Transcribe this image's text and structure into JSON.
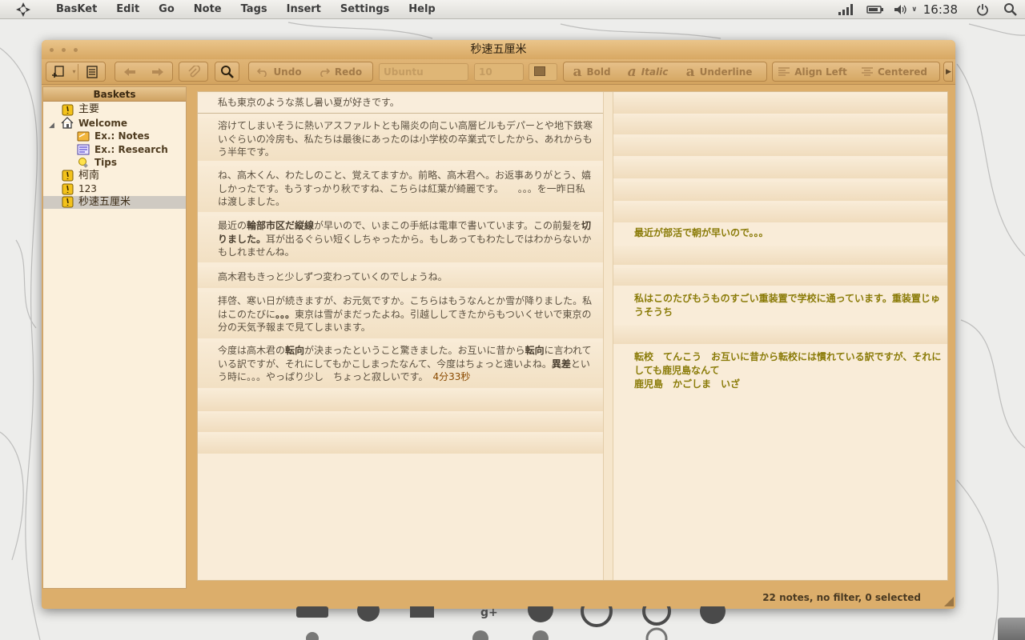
{
  "panel": {
    "menu": [
      "BasKet",
      "Edit",
      "Go",
      "Note",
      "Tags",
      "Insert",
      "Settings",
      "Help"
    ],
    "clock": "16:38",
    "tray_icons": [
      "network-signal-icon",
      "battery-icon",
      "volume-icon",
      "power-icon",
      "search-icon"
    ]
  },
  "window": {
    "title": "秒速五厘米"
  },
  "toolbar": {
    "undo": "Undo",
    "redo": "Redo",
    "font_family": "Ubuntu",
    "font_size": "10",
    "bold": "Bold",
    "italic": "Italic",
    "underline": "Underline",
    "align_left": "Align Left",
    "centered": "Centered"
  },
  "sidebar": {
    "header": "Baskets",
    "items": [
      {
        "label": "主要",
        "icon": "note-basket-icon"
      },
      {
        "label": "Welcome",
        "icon": "home-icon"
      },
      {
        "label": "Ex.: Notes",
        "icon": "folder-notes-icon"
      },
      {
        "label": "Ex.: Research",
        "icon": "research-icon"
      },
      {
        "label": "Tips",
        "icon": "lightbulb-icon"
      },
      {
        "label": "柯南",
        "icon": "note-basket-icon"
      },
      {
        "label": "123",
        "icon": "note-basket-icon"
      },
      {
        "label": "秒速五厘米",
        "icon": "note-basket-icon"
      }
    ]
  },
  "notes_left": {
    "n0": "私も東京のような蒸し暑い夏が好きです。",
    "n1": "溶けてしまいそうに熱いアスファルトとも陽炎の向こい高層ビルもデパーとや地下鉄寒いぐらいの冷房も、私たちは最後にあったのは小学校の卒業式でしたから、あれからもう半年です。",
    "n2": "ね、高木くん、わたしのこと、覚えてますか。前略、高木君へ。お返事ありがとう、嬉しかったです。もうすっかり秋ですね、こちらは紅葉が綺麗です。　　。。。を一昨日私は渡しました。",
    "n3a": "最近の",
    "n3b": "輪部市区だ縦線",
    "n3c": "が早いので、いまこの手紙は電車で書いています。この前髪を",
    "n3d": "切りました。",
    "n3e": "耳が出るぐらい短くしちゃったから。もしあってもわたしではわからないかもしれませんね。",
    "n4": "高木君もきっと少しずつ変わっていくのでしょうね。",
    "n5a": "拝啓、寒い日が続きますが、お元気ですか。こちらはもうなんとか雪が降りました。私はこのたびに",
    "n5b": "。。。",
    "n5c": "東京は雪がまだったよね。引越ししてきたからもついくせいで東京の分の天気予報まで見てしまいます。",
    "n6a": "今度は高木君の",
    "n6b": "転向",
    "n6c": "が決まったということ驚きました。お互いに昔から",
    "n6d": "転向",
    "n6e": "に言われている訳ですが、それにしてもかこしまったなんて、今度はちょっと遠いよね。",
    "n6f": "異差",
    "n6g": "という時に。。。やっぱり少し　ちょっと寂しいです。　",
    "n6time": "4分33秒"
  },
  "notes_right": {
    "r0": "最近が部活で朝が早いので。。。",
    "r1": "私はこのたびもうものすごい重装置で学校に通っています。重装置じゅうそうち",
    "r2": "転校　てんこう　お互いに昔から転校には慣れている訳ですが、それにしても鹿児島なんて",
    "r3": "鹿児島　かごしま　いざ"
  },
  "status": {
    "text": "22 notes, no filter, 0 selected"
  },
  "colors": {
    "window": "#dcae6b",
    "note_bg": "#f9ecd8",
    "right_note_text": "#8a7b08"
  }
}
